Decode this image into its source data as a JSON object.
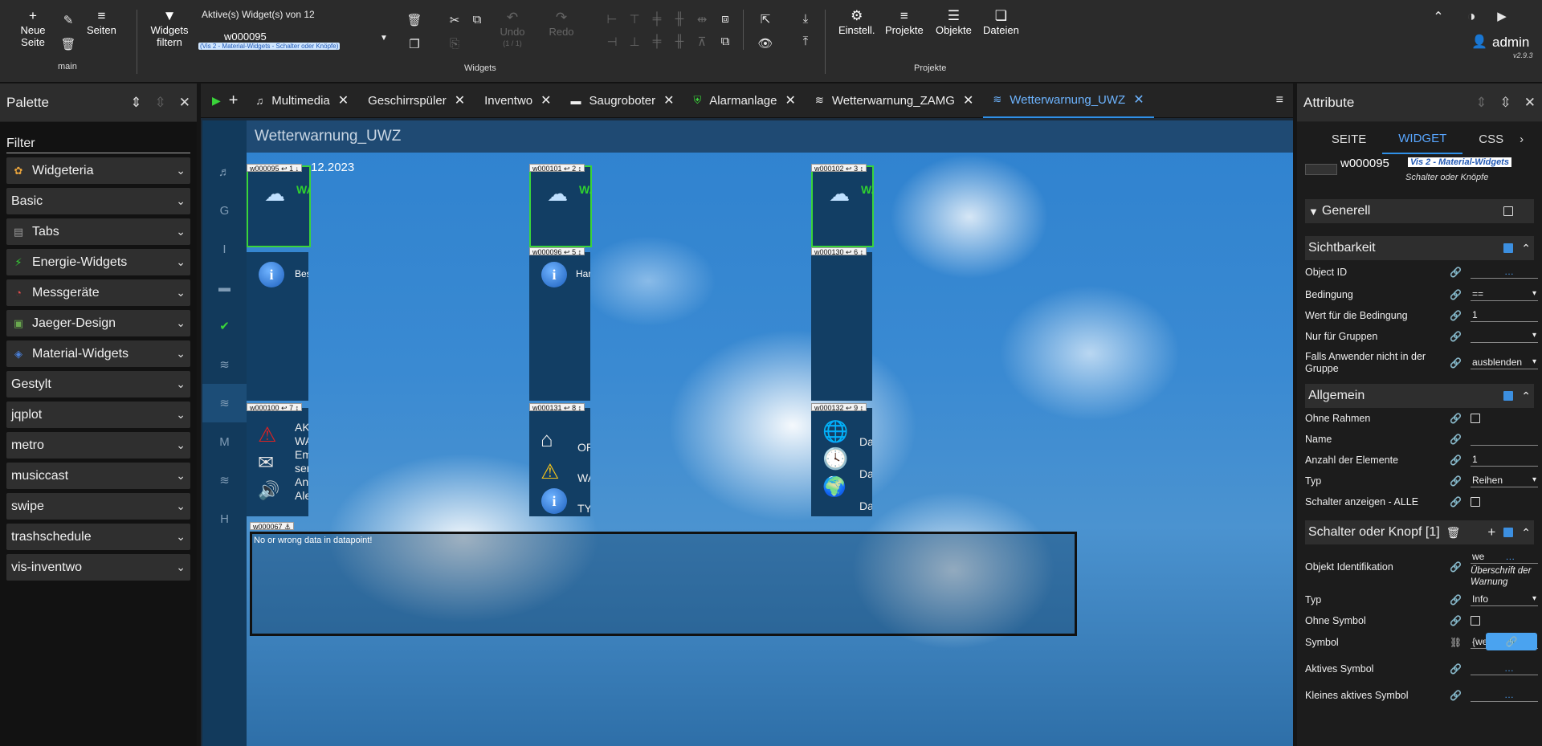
{
  "toolbar": {
    "new_page": "Neue Seite",
    "pages": "Seiten",
    "main_label": "main",
    "widgets_filter": "Widgets filtern",
    "active_widgets": "Aktive(s) Widget(s) von 12",
    "selected_widget": "w000095",
    "selected_widget_desc": "(Vis 2 - Material-Widgets - Schalter oder Knöpfe)",
    "undo": "Undo",
    "undo_count": "(1 / 1)",
    "redo": "Redo",
    "widgets_group": "Widgets",
    "settings": "Einstell.",
    "projects": "Projekte",
    "objects": "Objekte",
    "files": "Dateien",
    "projects_group": "Projekte",
    "user": "admin",
    "version": "v2.9.3"
  },
  "palette": {
    "title": "Palette",
    "filter_label": "Filter",
    "items": [
      {
        "label": "Widgeteria",
        "icon": "widgeteria-icon",
        "color": "#e8a33c"
      },
      {
        "label": "Basic",
        "icon": "",
        "color": ""
      },
      {
        "label": "Tabs",
        "icon": "tabs-icon",
        "color": "#999999"
      },
      {
        "label": "Energie-Widgets",
        "icon": "lightning-icon",
        "color": "#35d335"
      },
      {
        "label": "Messgeräte",
        "icon": "gauge-icon",
        "color": "#e34c4c"
      },
      {
        "label": "Jaeger-Design",
        "icon": "jaeger-icon",
        "color": "#6aa84f"
      },
      {
        "label": "Material-Widgets",
        "icon": "material-icon",
        "color": "#4a7fd8"
      },
      {
        "label": "Gestylt",
        "icon": "",
        "color": ""
      },
      {
        "label": "jqplot",
        "icon": "",
        "color": ""
      },
      {
        "label": "metro",
        "icon": "",
        "color": ""
      },
      {
        "label": "musiccast",
        "icon": "",
        "color": ""
      },
      {
        "label": "swipe",
        "icon": "",
        "color": ""
      },
      {
        "label": "trashschedule",
        "icon": "",
        "color": ""
      },
      {
        "label": "vis-inventwo",
        "icon": "",
        "color": ""
      }
    ]
  },
  "tabs": [
    {
      "label": "Multimedia",
      "icon": "music-note-icon"
    },
    {
      "label": "Geschirrspüler",
      "icon": ""
    },
    {
      "label": "Inventwo",
      "icon": ""
    },
    {
      "label": "Saugroboter",
      "icon": "robot-vacuum-icon"
    },
    {
      "label": "Alarmanlage",
      "icon": "shield-icon"
    },
    {
      "label": "Wetterwarnung_ZAMG",
      "icon": "haze-icon"
    },
    {
      "label": "Wetterwarnung_UWZ",
      "icon": "haze-icon"
    }
  ],
  "canvas": {
    "page_title": "Wetterwarnung_UWZ",
    "date_text": "12.2023",
    "left_nav": [
      "♬",
      "G",
      "I",
      "▬",
      "✔",
      "≋",
      "≋",
      "M",
      "≋",
      "H"
    ],
    "widgets": {
      "w95": {
        "id": "w000095",
        "num": "1",
        "label": "WA"
      },
      "w101": {
        "id": "w000101",
        "num": "2",
        "label": "WA"
      },
      "w102": {
        "id": "w000102",
        "num": "3",
        "label": "WA"
      },
      "w96": {
        "id": "w000096",
        "num": "5",
        "text": "Har"
      },
      "w130": {
        "id": "w000130",
        "num": "6"
      },
      "w100": {
        "id": "w000100",
        "num": "7",
        "lines": [
          "AK",
          "WA",
          "Em",
          "ser",
          "An",
          "Ale"
        ]
      },
      "w131": {
        "id": "w000131",
        "num": "8",
        "lines": [
          "OR",
          "WA",
          "TYI"
        ]
      },
      "w132": {
        "id": "w000132",
        "num": "9",
        "lines": [
          "Da",
          "Da",
          "Da"
        ]
      },
      "w_first_info": {
        "text": "Bes"
      },
      "w67": {
        "id": "w000067",
        "message": "No or wrong data in datapoint!"
      }
    }
  },
  "attributes": {
    "title": "Attribute",
    "tabs": [
      "SEITE",
      "WIDGET",
      "CSS"
    ],
    "widget_id": "w000095",
    "widget_set": "Vis 2 - Material-Widgets",
    "widget_type": "Schalter oder Knöpfe",
    "sections": {
      "generell": "Generell",
      "sichtbarkeit": "Sichtbarkeit",
      "allgemein": "Allgemein",
      "schalter": "Schalter oder Knopf [1]"
    },
    "visibility": {
      "object_id": "Object ID",
      "condition": "Bedingung",
      "condition_value": "==",
      "condition_for": "Wert für die Bedingung",
      "condition_for_value": "1",
      "groups_only": "Nur für Gruppen",
      "if_not_in_group": "Falls Anwender nicht in der Gruppe",
      "if_not_in_group_value": "ausblenden"
    },
    "general": {
      "no_frame": "Ohne Rahmen",
      "name": "Name",
      "count": "Anzahl der Elemente",
      "count_value": "1",
      "type": "Typ",
      "type_value": "Reihen",
      "show_all": "Schalter anzeigen - ALLE"
    },
    "switch": {
      "object_ident": "Objekt Identifikation",
      "object_ident_value": "we",
      "object_ident_note": "Überschrift der Warnung",
      "type": "Typ",
      "type_value": "Info",
      "no_symbol": "Ohne Symbol",
      "symbol": "Symbol",
      "symbol_value": "{we",
      "active_symbol": "Aktives Symbol",
      "small_active_symbol": "Kleines aktives Symbol"
    }
  }
}
